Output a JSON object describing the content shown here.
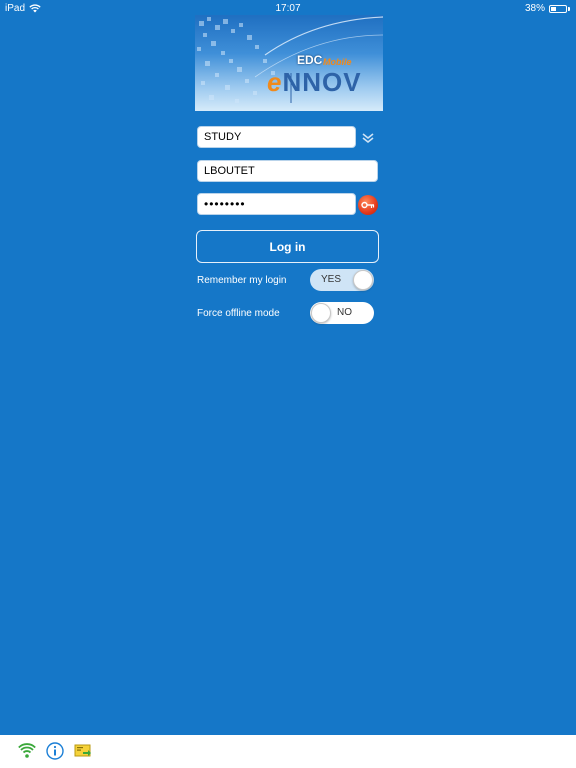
{
  "status_bar": {
    "device": "iPad",
    "time": "17:07",
    "battery_text": "38%",
    "battery_level": 0.38
  },
  "logo": {
    "edc": "EDC",
    "mobile": "Mobile",
    "brand_e": "e",
    "brand_rest": "NNOV"
  },
  "form": {
    "study_value": "STUDY",
    "login_value": "LBOUTET",
    "password_mask": "••••••••",
    "login_button_label": "Log in"
  },
  "options": {
    "remember_label": "Remember my login",
    "remember_state": "YES",
    "offline_label": "Force offline mode",
    "offline_state": "NO"
  },
  "bottom_bar": {
    "icons": [
      "wifi-icon",
      "info-icon",
      "export-icon"
    ]
  },
  "colors": {
    "background": "#1577c8",
    "wifi_green": "#3aa83a",
    "info_blue": "#1b7fd6",
    "key_red": "#e4391b"
  }
}
